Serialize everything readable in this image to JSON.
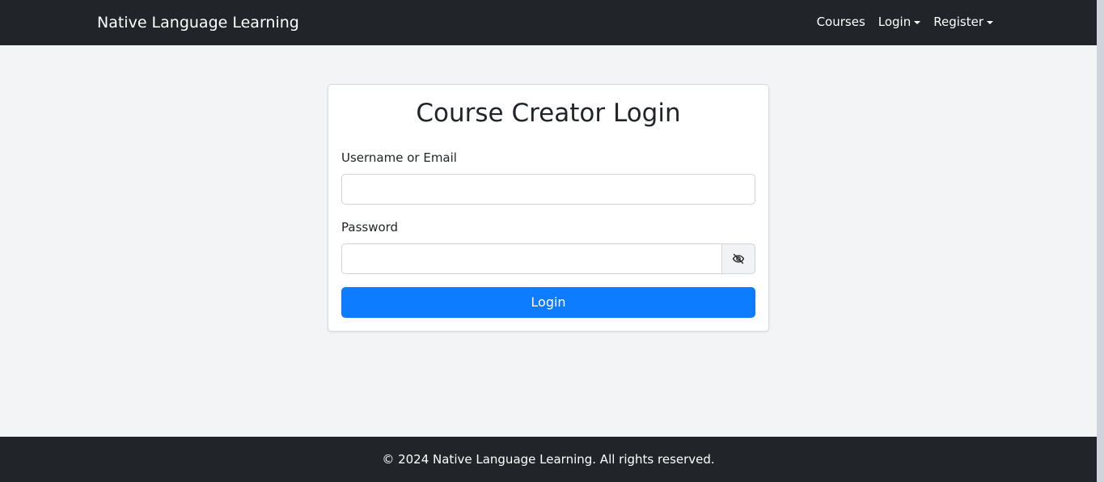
{
  "navbar": {
    "brand": "Native Language Learning",
    "links": [
      {
        "label": "Courses",
        "dropdown": false
      },
      {
        "label": "Login",
        "dropdown": true
      },
      {
        "label": "Register",
        "dropdown": true
      }
    ]
  },
  "login_card": {
    "title": "Course Creator Login",
    "username_label": "Username or Email",
    "username_value": "",
    "username_placeholder": "",
    "password_label": "Password",
    "password_value": "",
    "password_placeholder": "",
    "password_toggle_icon": "eye-slash-icon",
    "submit_label": "Login"
  },
  "footer": {
    "text": "© 2024 Native Language Learning. All rights reserved."
  },
  "colors": {
    "navbar_bg": "#212529",
    "page_bg": "#f3f4f6",
    "primary_button": "#0d7cff",
    "text_dark": "#212529"
  }
}
